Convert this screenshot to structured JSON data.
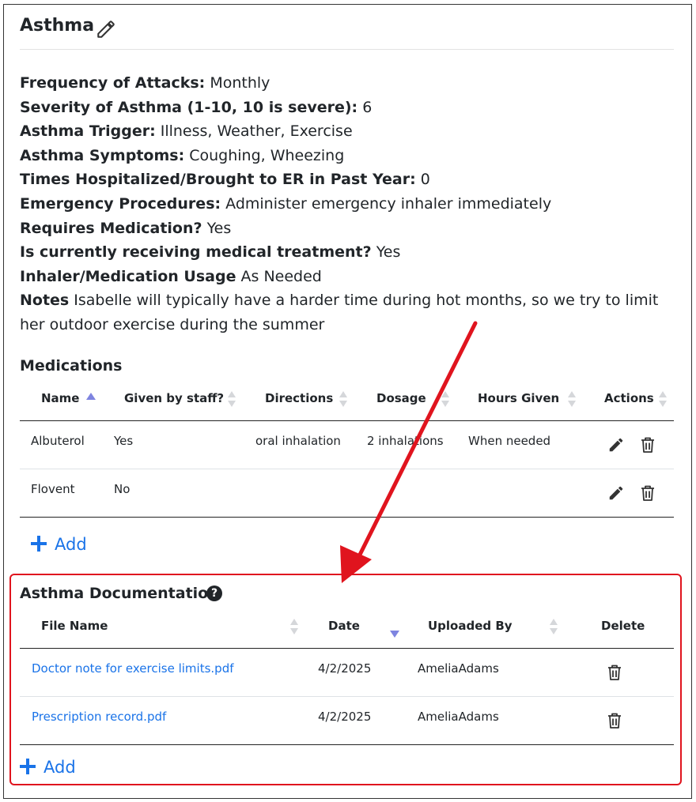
{
  "condition": {
    "title": "Asthma"
  },
  "details": [
    {
      "label": "Frequency of Attacks:",
      "value": "Monthly"
    },
    {
      "label": "Severity of Asthma (1-10, 10 is severe):",
      "value": "6"
    },
    {
      "label": "Asthma Trigger:",
      "value": "Illness, Weather, Exercise"
    },
    {
      "label": "Asthma Symptoms:",
      "value": "Coughing, Wheezing"
    },
    {
      "label": "Times Hospitalized/Brought to ER in Past Year:",
      "value": "0"
    },
    {
      "label": "Emergency Procedures:",
      "value": "Administer emergency inhaler immediately"
    },
    {
      "label": "Requires Medication?",
      "value": "Yes"
    },
    {
      "label": "Is currently receiving medical treatment?",
      "value": "Yes"
    },
    {
      "label": "Inhaler/Medication Usage",
      "value": "As Needed"
    },
    {
      "label": "Notes",
      "value": "Isabelle will typically have a harder time during hot months, so we try to limit her outdoor exercise during the summer"
    }
  ],
  "medications": {
    "title": "Medications",
    "columns": [
      "Name",
      "Given by staff?",
      "Directions",
      "Dosage",
      "Hours Given",
      "Actions"
    ],
    "rows": [
      {
        "name": "Albuterol",
        "given_by_staff": "Yes",
        "directions": "oral inhalation",
        "dosage": "2 inhalations",
        "hours_given": "When needed"
      },
      {
        "name": "Flovent",
        "given_by_staff": "No",
        "directions": "",
        "dosage": "",
        "hours_given": ""
      }
    ],
    "add_label": "Add"
  },
  "documentation": {
    "title": "Asthma Documentation",
    "help_glyph": "?",
    "columns": [
      "File Name",
      "Date",
      "Uploaded By",
      "Delete"
    ],
    "rows": [
      {
        "file_name": "Doctor note for exercise limits.pdf",
        "date": "4/2/2025",
        "uploaded_by": "AmeliaAdams"
      },
      {
        "file_name": "Prescription record.pdf",
        "date": "4/2/2025",
        "uploaded_by": "AmeliaAdams"
      }
    ],
    "add_label": "Add"
  },
  "colors": {
    "link": "#1a73e8",
    "highlight": "#e0141e",
    "sort_active": "#7e84e0"
  }
}
